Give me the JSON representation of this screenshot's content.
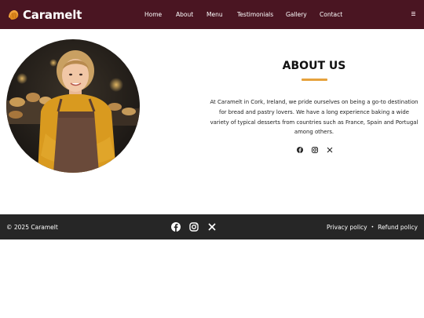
{
  "brand": {
    "name": "Caramelt",
    "icon": "croissant-icon",
    "accent": "#f2a33a"
  },
  "nav": {
    "items": [
      "Home",
      "About",
      "Menu",
      "Testimonials",
      "Gallery",
      "Contact"
    ],
    "menu_icon": "hamburger-icon"
  },
  "about": {
    "title": "ABOUT US",
    "paragraph": "At Caramelt in Cork, Ireland, we pride ourselves on being a go-to destination for bread and pastry lovers. We have a long experience baking a wide variety of typical desserts from countries such as France, Spain and Portugal among others.",
    "social_icons": [
      "facebook-icon",
      "instagram-icon",
      "x-icon"
    ]
  },
  "footer": {
    "copyright": "© 2025 Caramelt",
    "social_icons": [
      "facebook-icon",
      "instagram-icon",
      "x-icon"
    ],
    "links": [
      "Privacy policy",
      "Refund policy"
    ],
    "separator": "•"
  },
  "colors": {
    "header_bg": "#4a1522",
    "footer_bg": "#262626",
    "underline": "#e6a23c"
  }
}
